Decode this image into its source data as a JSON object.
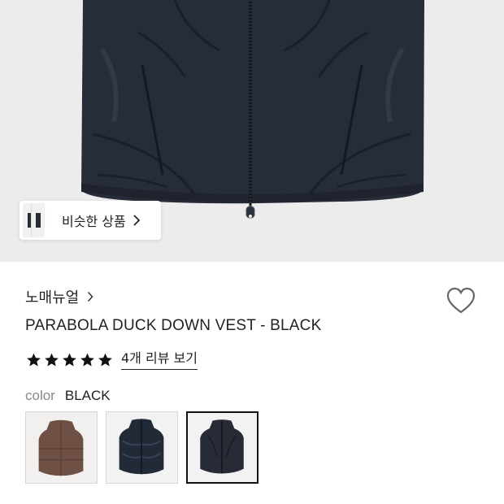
{
  "hero": {
    "image_icon": "black-puffer-vest-photo",
    "similar_products_label": "비슷한 상품"
  },
  "product": {
    "brand": "노매뉴얼",
    "title": "PARABOLA DUCK DOWN VEST - BLACK",
    "rating": 5,
    "review_link": "4개 리뷰 보기",
    "color_key": "color",
    "color_value": "BLACK",
    "swatches": [
      {
        "icon": "brown-vest-thumbnail",
        "color": "#6e5144"
      },
      {
        "icon": "navy-vest-thumbnail",
        "color": "#222a38"
      },
      {
        "icon": "black-vest-thumbnail",
        "color": "#262b36",
        "selected": true
      }
    ]
  },
  "colors": {
    "hero_bg": "#ececec",
    "vest_dark": "#262c38",
    "text_primary": "#222222",
    "text_muted": "#888888"
  }
}
